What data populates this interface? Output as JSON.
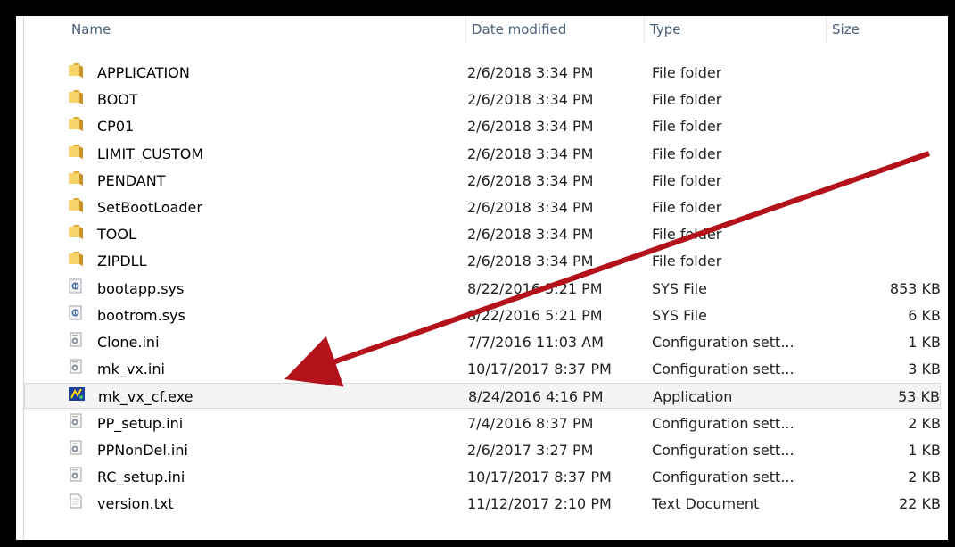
{
  "columns": {
    "name": "Name",
    "date": "Date modified",
    "type": "Type",
    "size": "Size"
  },
  "files": [
    {
      "name": "APPLICATION",
      "date": "2/6/2018 3:34 PM",
      "type": "File folder",
      "size": "",
      "icon": "folder-icon"
    },
    {
      "name": "BOOT",
      "date": "2/6/2018 3:34 PM",
      "type": "File folder",
      "size": "",
      "icon": "folder-icon"
    },
    {
      "name": "CP01",
      "date": "2/6/2018 3:34 PM",
      "type": "File folder",
      "size": "",
      "icon": "folder-icon"
    },
    {
      "name": "LIMIT_CUSTOM",
      "date": "2/6/2018 3:34 PM",
      "type": "File folder",
      "size": "",
      "icon": "folder-icon"
    },
    {
      "name": "PENDANT",
      "date": "2/6/2018 3:34 PM",
      "type": "File folder",
      "size": "",
      "icon": "folder-icon"
    },
    {
      "name": "SetBootLoader",
      "date": "2/6/2018 3:34 PM",
      "type": "File folder",
      "size": "",
      "icon": "folder-icon"
    },
    {
      "name": "TOOL",
      "date": "2/6/2018 3:34 PM",
      "type": "File folder",
      "size": "",
      "icon": "folder-icon"
    },
    {
      "name": "ZIPDLL",
      "date": "2/6/2018 3:34 PM",
      "type": "File folder",
      "size": "",
      "icon": "folder-icon"
    },
    {
      "name": "bootapp.sys",
      "date": "8/22/2016 5:21 PM",
      "type": "SYS File",
      "size": "853 KB",
      "icon": "system-file-icon"
    },
    {
      "name": "bootrom.sys",
      "date": "8/22/2016 5:21 PM",
      "type": "SYS File",
      "size": "6 KB",
      "icon": "system-file-icon"
    },
    {
      "name": "Clone.ini",
      "date": "7/7/2016 11:03 AM",
      "type": "Configuration sett...",
      "size": "1 KB",
      "icon": "config-file-icon"
    },
    {
      "name": "mk_vx.ini",
      "date": "10/17/2017 8:37 PM",
      "type": "Configuration sett...",
      "size": "3 KB",
      "icon": "config-file-icon"
    },
    {
      "name": "mk_vx_cf.exe",
      "date": "8/24/2016 4:16 PM",
      "type": "Application",
      "size": "53 KB",
      "icon": "application-icon",
      "selected": true
    },
    {
      "name": "PP_setup.ini",
      "date": "7/4/2016 8:37 PM",
      "type": "Configuration sett...",
      "size": "2 KB",
      "icon": "config-file-icon"
    },
    {
      "name": "PPNonDel.ini",
      "date": "2/6/2017 3:27 PM",
      "type": "Configuration sett...",
      "size": "1 KB",
      "icon": "config-file-icon"
    },
    {
      "name": "RC_setup.ini",
      "date": "10/17/2017 8:37 PM",
      "type": "Configuration sett...",
      "size": "2 KB",
      "icon": "config-file-icon"
    },
    {
      "name": "version.txt",
      "date": "11/12/2017 2:10 PM",
      "type": "Text Document",
      "size": "22 KB",
      "icon": "text-file-icon"
    }
  ],
  "colors": {
    "annotation_arrow": "#b3121b",
    "header_text": "#4c607a",
    "folder": "#e8b94a"
  }
}
